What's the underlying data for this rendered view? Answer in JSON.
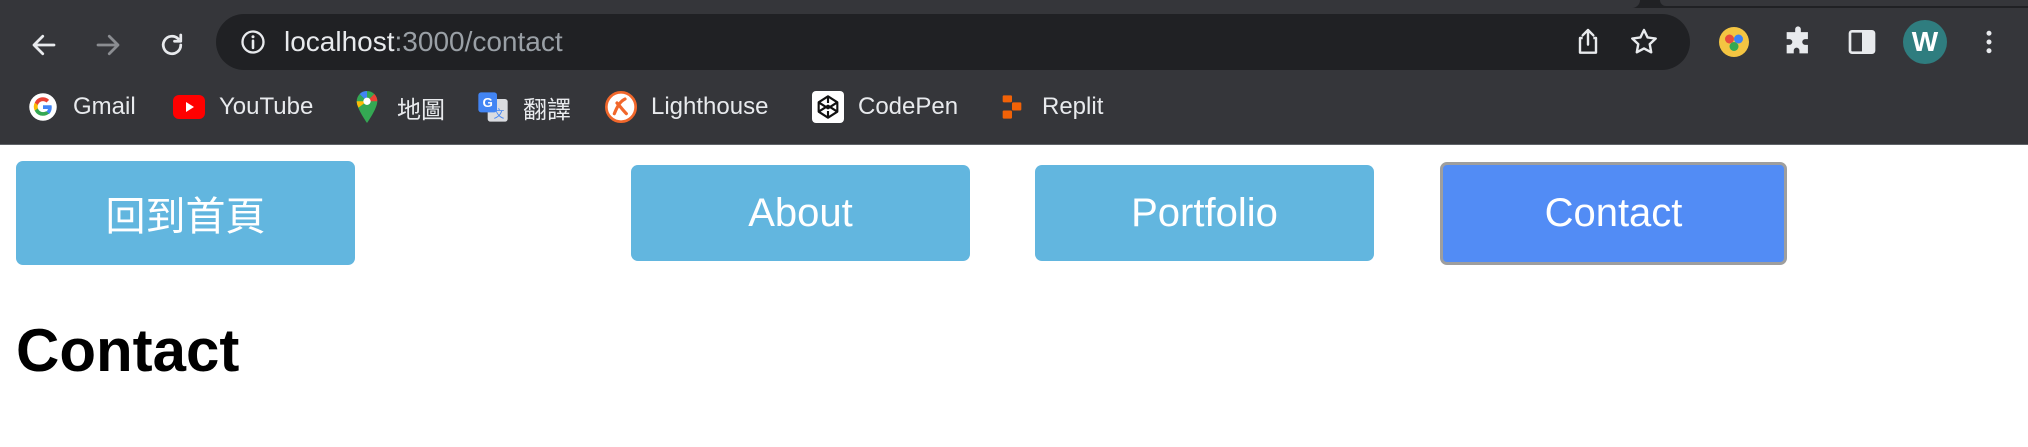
{
  "browser": {
    "url_host": "localhost",
    "url_path": ":3000/contact",
    "profile_initial": "W",
    "icons": {
      "back": "back-arrow-icon",
      "forward": "forward-arrow-icon",
      "reload": "reload-icon",
      "site_info": "info-icon",
      "share": "share-icon",
      "bookmark_star": "star-icon",
      "extension_1": "colorful-extension-icon",
      "extensions": "puzzle-icon",
      "side_panel": "side-panel-icon",
      "menu": "kebab-menu-icon"
    },
    "bookmarks": [
      {
        "label": "Gmail",
        "icon": "google-icon"
      },
      {
        "label": "YouTube",
        "icon": "youtube-icon"
      },
      {
        "label": "地圖",
        "icon": "maps-pin-icon"
      },
      {
        "label": "翻譯",
        "icon": "translate-icon"
      },
      {
        "label": "Lighthouse",
        "icon": "lighthouse-icon"
      },
      {
        "label": "CodePen",
        "icon": "codepen-icon"
      },
      {
        "label": "Replit",
        "icon": "replit-icon"
      }
    ]
  },
  "page": {
    "nav": {
      "home": "回到首頁",
      "about": "About",
      "portfolio": "Portfolio",
      "contact": "Contact"
    },
    "heading": "Contact"
  },
  "colors": {
    "chrome_bg": "#35363a",
    "omnibox_bg": "#202124",
    "nav_button": "#62b6df",
    "nav_button_active": "#528cf5"
  }
}
